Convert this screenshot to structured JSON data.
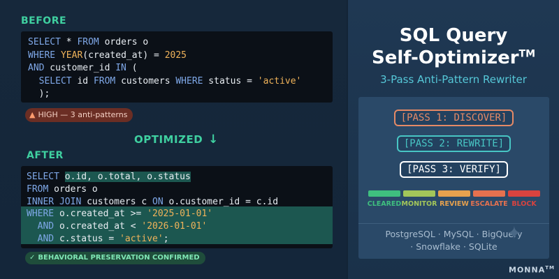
{
  "before": {
    "label": "BEFORE",
    "code": [
      [
        [
          "kw",
          "SELECT"
        ],
        [
          "t",
          " * "
        ],
        [
          "kw",
          "FROM"
        ],
        [
          "t",
          " orders o"
        ]
      ],
      [
        [
          "kw",
          "WHERE"
        ],
        [
          "t",
          " "
        ],
        [
          "fn",
          "YEAR"
        ],
        [
          "t",
          "(created_at) = "
        ],
        [
          "num",
          "2025"
        ]
      ],
      [
        [
          "kw",
          "AND"
        ],
        [
          "t",
          " customer_id "
        ],
        [
          "kw",
          "IN"
        ],
        [
          "t",
          " ("
        ]
      ],
      [
        [
          "t",
          "  "
        ],
        [
          "kw",
          "SELECT"
        ],
        [
          "t",
          " id "
        ],
        [
          "kw",
          "FROM"
        ],
        [
          "t",
          " customers "
        ],
        [
          "kw",
          "WHERE"
        ],
        [
          "t",
          " status = "
        ],
        [
          "str",
          "'active'"
        ]
      ],
      [
        [
          "t",
          "  );"
        ]
      ]
    ],
    "badge": "HIGH — 3 anti-patterns",
    "badge_icon": "warning-icon"
  },
  "optimized": {
    "label": "OPTIMIZED",
    "icon": "arrow-down-icon"
  },
  "after": {
    "label": "AFTER",
    "code": [
      [
        [
          "kw",
          "SELECT"
        ],
        [
          "t",
          " "
        ],
        [
          "hl",
          "o.id, o.total, o.status"
        ]
      ],
      [
        [
          "kw",
          "FROM"
        ],
        [
          "t",
          " orders o"
        ]
      ],
      [
        [
          "kw",
          "INNER JOIN"
        ],
        [
          "t",
          " customers c "
        ],
        [
          "kw",
          "ON"
        ],
        [
          "t",
          " o.customer_id = c.id"
        ]
      ],
      [
        [
          "kw",
          "WHERE"
        ],
        [
          "t",
          " o.created_at >= "
        ],
        [
          "str",
          "'2025-01-01'"
        ]
      ],
      [
        [
          "t",
          "  "
        ],
        [
          "kw",
          "AND"
        ],
        [
          "t",
          " o.created_at < "
        ],
        [
          "str",
          "'2026-01-01'"
        ]
      ],
      [
        [
          "t",
          "  "
        ],
        [
          "kw",
          "AND"
        ],
        [
          "t",
          " c.status = "
        ],
        [
          "str",
          "'active'"
        ],
        [
          "t",
          ";"
        ]
      ]
    ],
    "highlighted_lines": [
      3,
      4,
      5
    ],
    "badge": "BEHAVIORAL PRESERVATION CONFIRMED",
    "badge_icon": "check-icon"
  },
  "title": {
    "line1": "SQL Query",
    "line2": "Self-Optimizer",
    "trademark": "TM"
  },
  "subtitle": "3-Pass Anti-Pattern Rewriter",
  "passes": [
    "[PASS 1: DISCOVER]",
    "[PASS 2: REWRITE]",
    "[PASS 3: VERIFY]"
  ],
  "scale": [
    {
      "label": "CLEARED",
      "color": "#3fbf7f"
    },
    {
      "label": "MONITOR",
      "color": "#a3c65a"
    },
    {
      "label": "REVIEW",
      "color": "#e6a14e"
    },
    {
      "label": "ESCALATE",
      "color": "#e5714f"
    },
    {
      "label": "BLOCK",
      "color": "#d9433f"
    }
  ],
  "databases": {
    "line1": "PostgreSQL · MySQL · BigQuery",
    "line2": "· Snowflake · SQLite"
  },
  "brand": {
    "name": "MONNA",
    "trademark": "TM"
  }
}
